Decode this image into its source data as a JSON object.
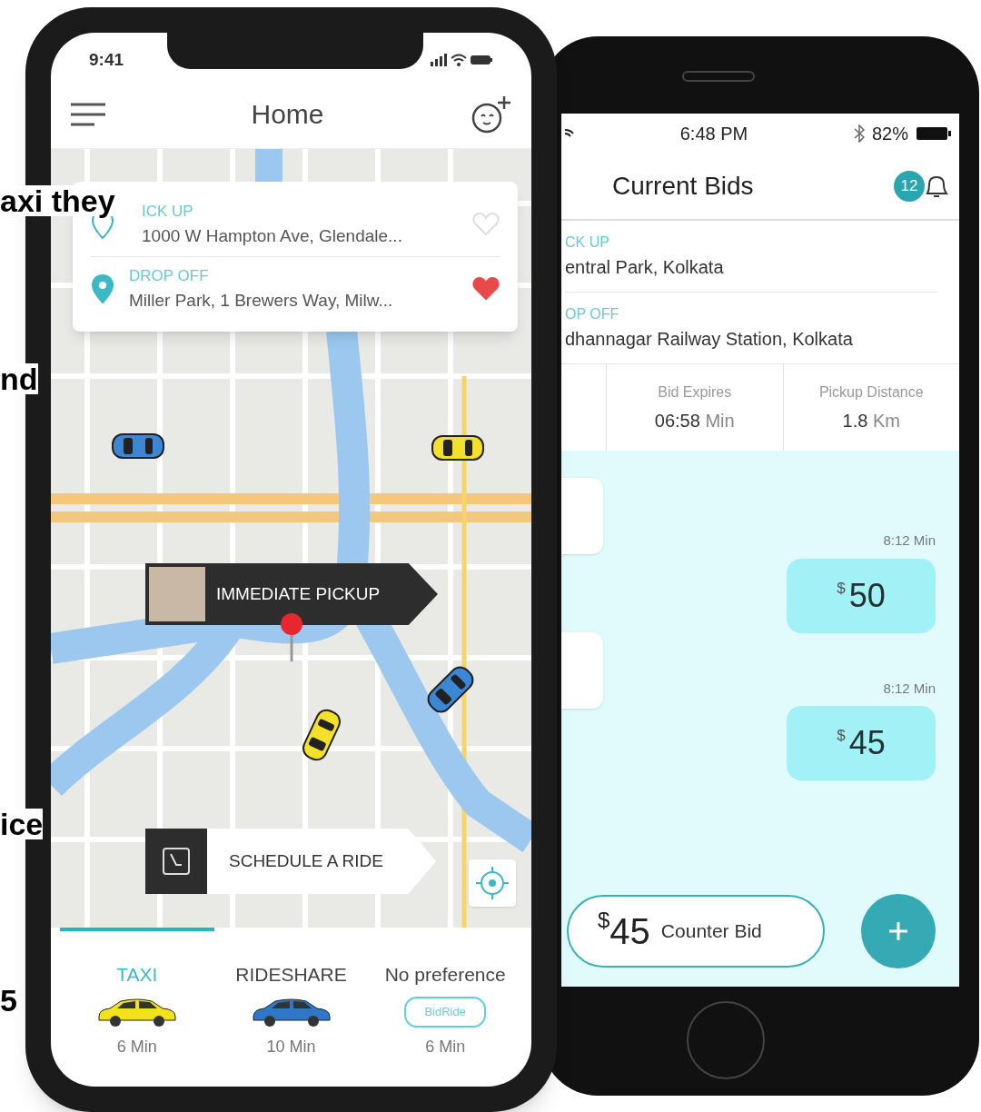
{
  "background_text": [
    {
      "text": "axi they"
    },
    {
      "text": "nd"
    },
    {
      "text": "ice"
    },
    {
      "text": "5"
    }
  ],
  "home_phone": {
    "status_bar": {
      "time": "9:41"
    },
    "title": "Home",
    "route": [
      {
        "label": "ICK UP",
        "address": "1000 W Hampton Ave, Glendale...",
        "favorite": false
      },
      {
        "label": "DROP OFF",
        "address": "Miller Park, 1 Brewers Way, Milw...",
        "favorite": true
      }
    ],
    "pickup_callout": "IMMEDIATE PICKUP",
    "schedule_button": "SCHEDULE A RIDE",
    "ride_types": [
      {
        "label": "TAXI",
        "eta": "6 Min",
        "selected": true,
        "kind": "taxi"
      },
      {
        "label": "RIDESHARE",
        "eta": "10 Min",
        "selected": false,
        "kind": "rideshare"
      },
      {
        "label": "No preference",
        "eta": "6 Min",
        "selected": false,
        "kind": "any",
        "logo_text": "BidRide"
      }
    ]
  },
  "bids_phone": {
    "status_bar": {
      "time": "6:48 PM",
      "battery": "82%"
    },
    "title": "Current Bids",
    "notification_count": "12",
    "route": [
      {
        "label": "CK UP",
        "address": "entral Park, Kolkata"
      },
      {
        "label": "OP OFF",
        "address": "dhannagar Railway Station, Kolkata"
      }
    ],
    "stats": [
      {
        "label": "Bid Expires",
        "value": "06:58",
        "unit": "Min"
      },
      {
        "label": "Pickup Distance",
        "value": "1.8",
        "unit": "Km"
      }
    ],
    "bids": [
      {
        "time": "8:12 Min",
        "currency": "$",
        "amount": "50"
      },
      {
        "time": "8:12 Min",
        "currency": "$",
        "amount": "45"
      }
    ],
    "counter_bid": {
      "currency": "$",
      "amount": "45",
      "label": "Counter Bid"
    }
  }
}
